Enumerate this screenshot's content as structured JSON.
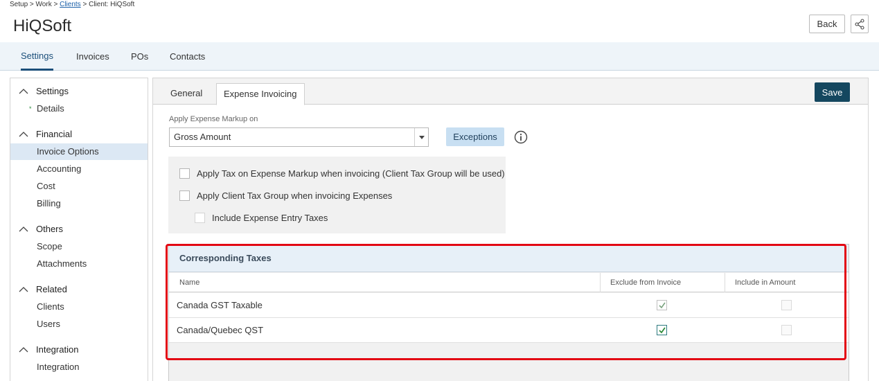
{
  "breadcrumb": {
    "setup": "Setup",
    "work": "Work",
    "clients": "Clients",
    "current": "Client: HiQSoft",
    "sep": ">"
  },
  "page": {
    "title": "HiQSoft"
  },
  "header": {
    "back_label": "Back",
    "share_icon": "share-icon"
  },
  "topnav": {
    "tabs": [
      "Settings",
      "Invoices",
      "POs",
      "Contacts"
    ],
    "active": "Settings"
  },
  "sidebar": {
    "groups": [
      {
        "label": "Settings",
        "items": [
          "Details"
        ]
      },
      {
        "label": "Financial",
        "items": [
          "Invoice Options",
          "Accounting",
          "Cost",
          "Billing"
        ]
      },
      {
        "label": "Others",
        "items": [
          "Scope",
          "Attachments"
        ]
      },
      {
        "label": "Related",
        "items": [
          "Clients",
          "Users"
        ]
      },
      {
        "label": "Integration",
        "items": [
          "Integration"
        ]
      }
    ],
    "active_item": "Invoice Options",
    "required_marker": "*"
  },
  "main": {
    "tabs": [
      "General",
      "Expense Invoicing"
    ],
    "active_tab": "Expense Invoicing",
    "save_label": "Save",
    "markup_label": "Apply Expense Markup on",
    "markup_value": "Gross Amount",
    "exceptions_label": "Exceptions",
    "options": [
      {
        "label": "Apply Tax on Expense Markup when invoicing (Client Tax Group will be used)",
        "checked": false
      },
      {
        "label": "Apply Client Tax Group when invoicing Expenses",
        "checked": false
      },
      {
        "label": "Include Expense Entry Taxes",
        "checked": false
      }
    ]
  },
  "taxes": {
    "title": "Corresponding Taxes",
    "columns": [
      "Name",
      "Exclude from Invoice",
      "Include in Amount"
    ],
    "rows": [
      {
        "name": "Canada GST Taxable",
        "exclude": true,
        "include": false
      },
      {
        "name": "Canada/Quebec QST",
        "exclude": true,
        "include": false
      }
    ]
  },
  "colors": {
    "accent": "#14475f",
    "highlight": "#e30613",
    "check": "#2e8b3a"
  }
}
